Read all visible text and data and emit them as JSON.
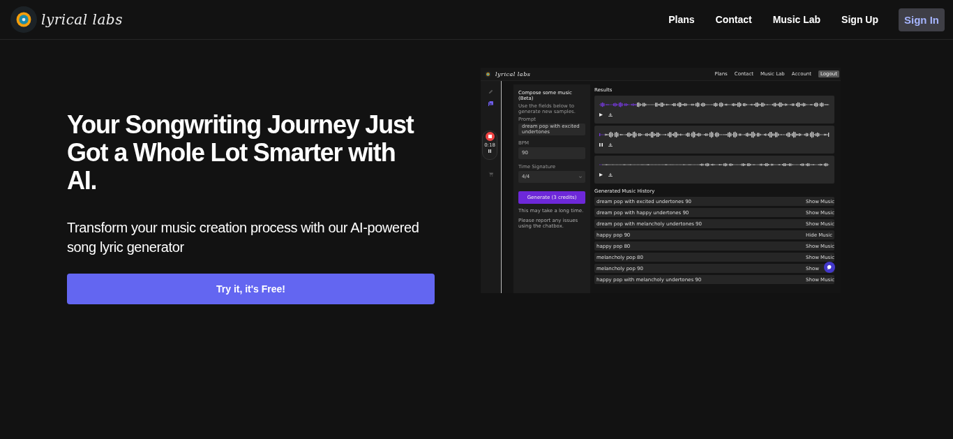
{
  "header": {
    "logo": "lyrical labs",
    "nav": [
      {
        "label": "Plans",
        "kind": "link"
      },
      {
        "label": "Contact",
        "kind": "link"
      },
      {
        "label": "Music Lab",
        "kind": "link"
      },
      {
        "label": "Sign Up",
        "kind": "link"
      },
      {
        "label": "Sign In",
        "kind": "button"
      }
    ]
  },
  "hero": {
    "title": "Your Songwriting Journey Just Got a Whole Lot Smarter with AI.",
    "subtitle": "Transform your music creation process with our AI-powered song lyric generator",
    "cta": "Try it, it's Free!"
  },
  "preview": {
    "logo": "lyrical labs",
    "nav": [
      "Plans",
      "Contact",
      "Music Lab",
      "Account"
    ],
    "logout": "Logout",
    "sidebar": [
      {
        "kind": "pen",
        "selected": false
      },
      {
        "kind": "library",
        "selected": true
      },
      {
        "kind": "cart",
        "selected": false
      }
    ],
    "recorder": {
      "time": "0:18"
    },
    "compose": {
      "title": "Compose some music (Beta)",
      "hint": "Use the fields below to generate new samples.",
      "fields": [
        {
          "label": "Prompt",
          "value": "dream pop with excited undertones",
          "kind": "text"
        },
        {
          "label": "BPM",
          "value": "90",
          "kind": "text"
        },
        {
          "label": "Time Signature",
          "value": "4/4",
          "kind": "select"
        }
      ],
      "button": "Generate (3 credits)",
      "notes": [
        "This may take a long time.",
        "Please report any issues using the chatbox."
      ]
    },
    "results": {
      "title": "Results",
      "tracks": [
        {
          "playing": false,
          "level": 0.16
        },
        {
          "playing": true,
          "level": 0.02
        },
        {
          "playing": false,
          "level": 0.01
        }
      ]
    },
    "history": {
      "title": "Generated Music History",
      "rows": [
        {
          "label": "dream pop with excited undertones 90",
          "action": "Show Music"
        },
        {
          "label": "dream pop with happy undertones 90",
          "action": "Show Music"
        },
        {
          "label": "dream pop with melancholy undertones 90",
          "action": "Show Music"
        },
        {
          "label": "happy pop 90",
          "action": "Hide Music"
        },
        {
          "label": "happy pop 80",
          "action": "Show Music"
        },
        {
          "label": "melancholy pop 80",
          "action": "Show Music"
        },
        {
          "label": "melancholy pop 90",
          "action": "Show"
        },
        {
          "label": "happy pop with melancholy undertones 90",
          "action": "Show Music"
        }
      ]
    }
  }
}
